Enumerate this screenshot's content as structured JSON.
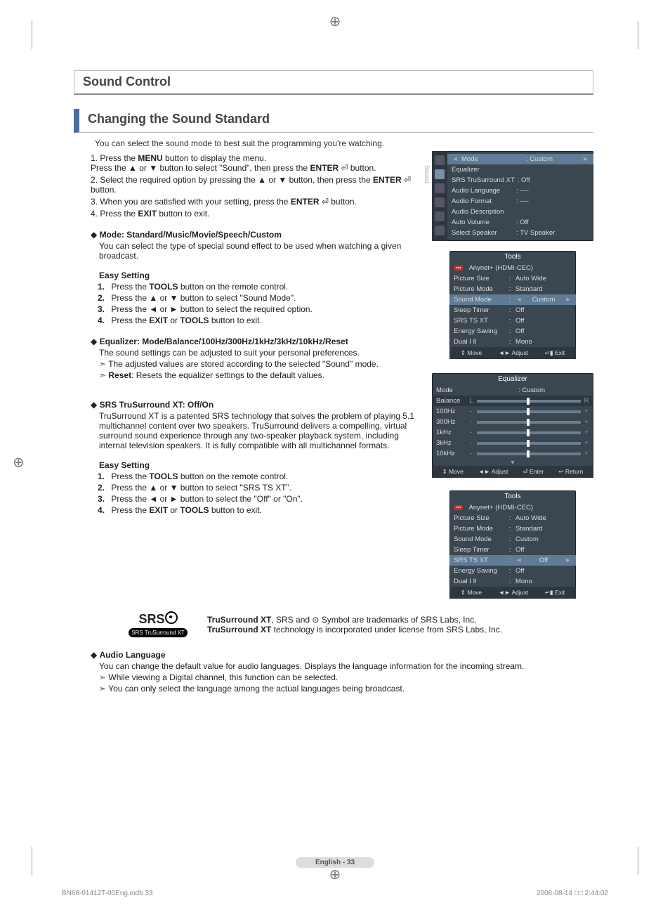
{
  "sectionTitle": "Sound Control",
  "subTitle": "Changing the Sound Standard",
  "intro": "You can select the sound mode to best suit the programming you're watching.",
  "mainSteps": [
    "Press the <b>MENU</b> button to display the menu.<br>Press the ▲ or ▼ button to select \"Sound\", then press the <b>ENTER</b> ⏎ button.",
    "Select the required option by pressing the ▲ or ▼ button, then press the <b>ENTER</b> ⏎ button.",
    "When you are satisfied with your setting, press the <b>ENTER</b> ⏎ button.",
    "Press the <b>EXIT</b> button to exit."
  ],
  "modeHead": "Mode: Standard/Music/Movie/Speech/Custom",
  "modePara": "You can select the type of special sound effect to be used when watching a given broadcast.",
  "easyHead": "Easy Setting",
  "easySteps1": [
    "Press the <b>TOOLS</b> button on the remote control.",
    "Press the ▲ or ▼ button to select \"Sound Mode\".",
    "Press the ◄ or ► button to select the required option.",
    "Press the <b>EXIT</b> or <b>TOOLS</b> button to exit."
  ],
  "eqHead": "Equalizer: Mode/Balance/100Hz/300Hz/1kHz/3kHz/10kHz/Reset",
  "eqPara": "The sound settings can be adjusted to suit your personal preferences.",
  "eqArrow1": "The adjusted values are stored according to the selected \"Sound\" mode.",
  "eqArrow2": "<b>Reset</b>: Resets the equalizer settings to the default values.",
  "srsHead": "SRS TruSurround XT: Off/On",
  "srsPara": "TruSurround XT is a patented SRS technology that solves the problem of playing 5.1 multichannel content over two speakers. TruSurround delivers a compelling, virtual surround sound experience through any two-speaker playback system, including internal television speakers. It is fully compatible with all multichannel formats.",
  "easySteps2": [
    "Press the <b>TOOLS</b> button on the remote control.",
    "Press the ▲ or ▼ button to select \"SRS TS XT\".",
    "Press the ◄ or ► button to select the \"Off\" or \"On\".",
    "Press the <b>EXIT</b> or <b>TOOLS</b> button to exit."
  ],
  "srsBox1": "<b>TruSurround XT</b>, SRS and ⊙ Symbol are trademarks of SRS Labs, Inc.",
  "srsBox2": "<b>TruSurround XT</b> technology is incorporated under license from SRS Labs, Inc.",
  "srsLogoPill": "SRS TruSurround XT",
  "audioLangHead": "Audio Language",
  "audioLangPara": "You can change the default value for audio languages. Displays the language information for the incoming stream.",
  "audioLangA1": "While viewing a Digital channel, this function can be selected.",
  "audioLangA2": "You can only select the language among the actual languages being broadcast.",
  "osd1": {
    "sidebar": "Sound",
    "rows": [
      {
        "k": "Mode",
        "v": ": Custom",
        "sel": true,
        "arrow": true
      },
      {
        "k": "Equalizer",
        "v": ""
      },
      {
        "k": "SRS TruSurround XT",
        "v": ": Off"
      },
      {
        "k": "Audio Language",
        "v": ": ----"
      },
      {
        "k": "Audio Format",
        "v": ": ----"
      },
      {
        "k": "Audio Description",
        "v": ""
      },
      {
        "k": "Auto Volume",
        "v": ": Off"
      },
      {
        "k": "Select Speaker",
        "v": ": TV Speaker"
      }
    ]
  },
  "osd2": {
    "title": "Tools",
    "anynet": "Anynet+ (HDMI-CEC)",
    "rows": [
      {
        "k": "Picture Size",
        "v": "Auto Wide"
      },
      {
        "k": "Picture Mode",
        "v": "Standard"
      },
      {
        "k": "Sound Mode",
        "v": "Custom",
        "sel": true,
        "lr": true
      },
      {
        "k": "Sleep Timer",
        "v": "Off"
      },
      {
        "k": "SRS TS XT",
        "v": "Off"
      },
      {
        "k": "Energy Saving",
        "v": "Off"
      },
      {
        "k": "Dual I II",
        "v": "Mono"
      }
    ],
    "footer": [
      "⇕ Move",
      "◄► Adjust",
      "↵▮ Exit"
    ]
  },
  "osd3": {
    "title": "Equalizer",
    "modeRow": {
      "k": "Mode",
      "v": ": Custom"
    },
    "bands": [
      {
        "lbl": "Balance",
        "l": "L",
        "r": "R"
      },
      {
        "lbl": "100Hz",
        "l": "-",
        "r": "+"
      },
      {
        "lbl": "300Hz",
        "l": "-",
        "r": "+"
      },
      {
        "lbl": "1kHz",
        "l": "-",
        "r": "+"
      },
      {
        "lbl": "3kHz",
        "l": "-",
        "r": "+"
      },
      {
        "lbl": "10kHz",
        "l": "-",
        "r": "+"
      }
    ],
    "footer": [
      "⇕ Move",
      "◄► Adjust",
      "⏎ Enter",
      "↩ Return"
    ]
  },
  "osd4": {
    "title": "Tools",
    "anynet": "Anynet+ (HDMI-CEC)",
    "rows": [
      {
        "k": "Picture Size",
        "v": "Auto Wide"
      },
      {
        "k": "Picture Mode",
        "v": "Standard"
      },
      {
        "k": "Sound Mode",
        "v": "Custom"
      },
      {
        "k": "Sleep Timer",
        "v": "Off"
      },
      {
        "k": "SRS TS XT",
        "v": "Off",
        "sel": true,
        "lr": true
      },
      {
        "k": "Energy Saving",
        "v": "Off"
      },
      {
        "k": "Dual I II",
        "v": "Mono"
      }
    ],
    "footer": [
      "⇕ Move",
      "◄► Adjust",
      "↵▮ Exit"
    ]
  },
  "pageBadge": "English - 33",
  "footLeft": "BN68-01412T-00Eng.indb   33",
  "footRight": "2008-08-14   □□ 2:44:02"
}
